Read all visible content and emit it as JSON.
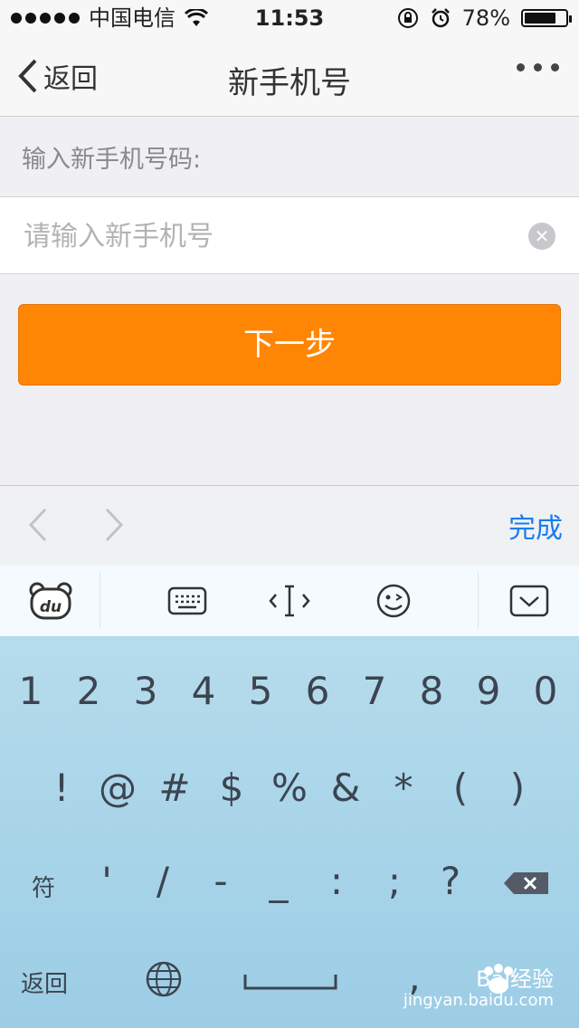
{
  "status_bar": {
    "carrier": "中国电信",
    "time": "11:53",
    "battery_percent": "78%",
    "battery_level": 0.78,
    "icons": [
      "signal-dots-icon",
      "wifi-icon",
      "rotation-lock-icon",
      "alarm-icon",
      "battery-icon"
    ]
  },
  "nav": {
    "back_label": "返回",
    "title": "新手机号",
    "more_icon": "more-dots-icon"
  },
  "form": {
    "label": "输入新手机号码:",
    "input_placeholder": "请输入新手机号",
    "input_value": "",
    "next_button": "下一步"
  },
  "accessory_bar": {
    "done_label": "完成"
  },
  "keyboard_toolbar": {
    "icons": [
      "baidu-du-icon",
      "keyboard-icon",
      "cursor-icon",
      "emoji-icon",
      "hide-keyboard-icon"
    ]
  },
  "keyboard": {
    "row1": [
      "1",
      "2",
      "3",
      "4",
      "5",
      "6",
      "7",
      "8",
      "9",
      "0"
    ],
    "row2": [
      "!",
      "@",
      "#",
      "$",
      "%",
      "&",
      "*",
      "(",
      ")"
    ],
    "row3": [
      "符",
      "'",
      "/",
      "-",
      "_",
      ":",
      ";",
      "?"
    ],
    "row4": [
      "返回",
      ","
    ],
    "watermark_brand": "Bai经验",
    "watermark_url": "jingyan.baidu.com"
  },
  "colors": {
    "accent_orange": "#ff8605",
    "link_blue": "#1a7cf0",
    "keyboard_blue": "#a7d4ea"
  }
}
